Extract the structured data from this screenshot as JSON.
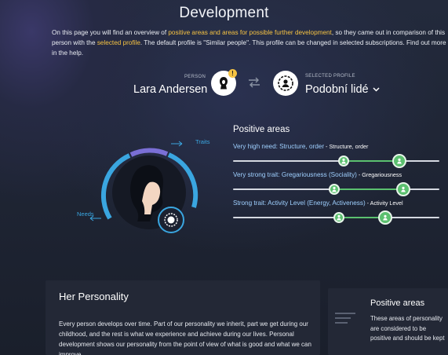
{
  "page": {
    "title": "Development"
  },
  "intro": {
    "p1": "On this page you will find an overview of ",
    "hl1": "positive areas and areas for possible further development",
    "p2": ", so they came out in comparison of this person with the ",
    "hl2": "selected profile",
    "p3": ". The default profile is \"Similar people\". This profile can be changed in selected subscriptions. Find out more in the help."
  },
  "person": {
    "label": "PERSON",
    "name": "Lara Andersen",
    "badge": "!"
  },
  "profile": {
    "label": "SELECTED PROFILE",
    "value": "Podobní lidé"
  },
  "wheel": {
    "traits_label": "Traits",
    "needs_label": "Needs"
  },
  "positive": {
    "title": "Positive areas",
    "rows": [
      {
        "label": "Very high need: Structure, order",
        "sep": " - ",
        "sub": "Structure, order",
        "small_pos": 0.5,
        "large_pos": 0.82
      },
      {
        "label": "Very strong trait: Gregariousness (Sociality)",
        "sep": " - ",
        "sub": "Gregariousness",
        "small_pos": 0.5,
        "large_pos": 0.84
      },
      {
        "label": "Strong trait: Activity Level (Energy, Activeness)",
        "sep": " - ",
        "sub": "Activity Level",
        "small_pos": 0.52,
        "large_pos": 0.75
      }
    ]
  },
  "personality": {
    "title": "Her Personality",
    "text": "Every person develops over time. Part of our personality we inherit, part we get during our childhood, and the rest is what we experience and achieve during our lives. Personal development shows our personality from the point of view of what is good and what we can improve."
  },
  "side": {
    "title": "Positive areas",
    "text": "These areas of personality are considered to be positive and should be kept"
  },
  "colors": {
    "accent_yellow": "#f6c343",
    "green": "#5bc06f",
    "blue": "#3aa6e0",
    "purple": "#7a6fd6"
  }
}
